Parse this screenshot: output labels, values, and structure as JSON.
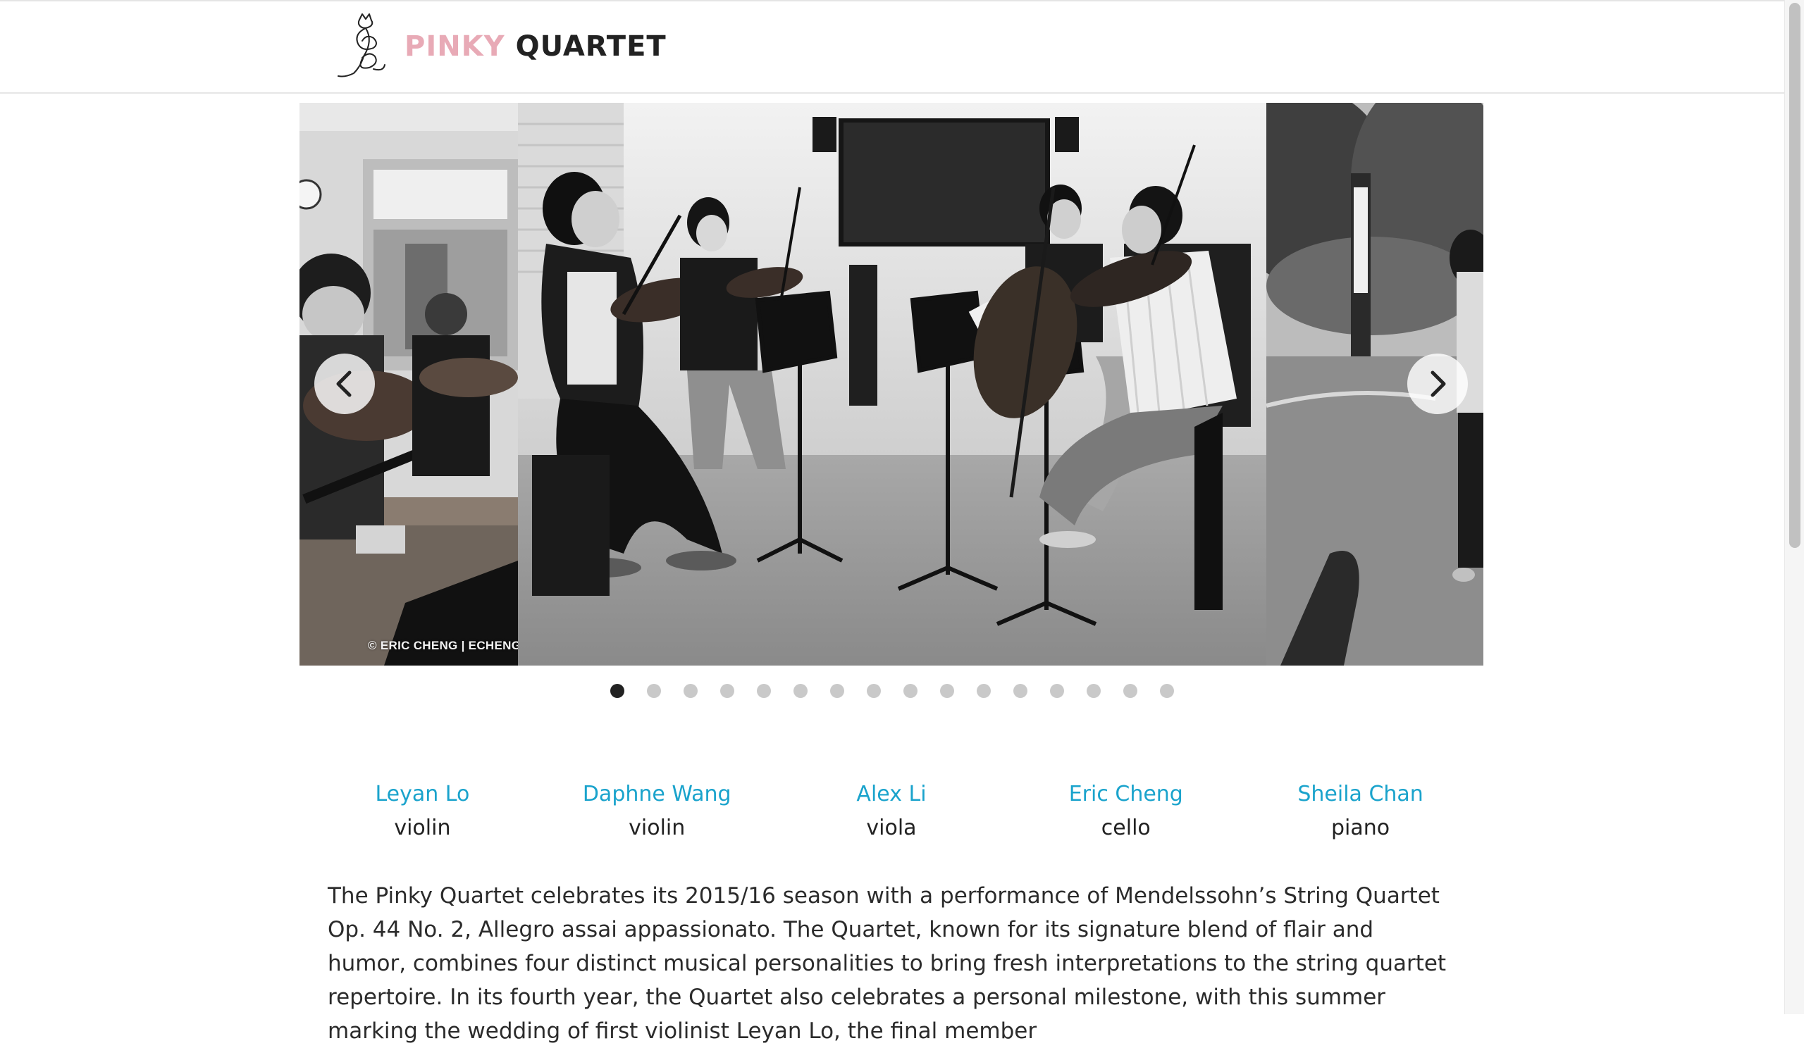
{
  "header": {
    "brand_part1": "PINKY",
    "brand_part2": "QUARTET",
    "logo_icon": "cat-treble-clef-icon"
  },
  "colors": {
    "brand_pink": "#e8aab6",
    "link_blue": "#1aa3cc",
    "text": "#222222",
    "dot_inactive": "#c9c9c9",
    "dot_active": "#222222"
  },
  "carousel": {
    "watermark": "© ERIC CHENG | ECHENG.",
    "prev_icon": "chevron-left-icon",
    "next_icon": "chevron-right-icon",
    "slide_count": 16,
    "active_slide": 1
  },
  "members": [
    {
      "name": "Leyan Lo",
      "instrument": "violin"
    },
    {
      "name": "Daphne Wang",
      "instrument": "violin"
    },
    {
      "name": "Alex Li",
      "instrument": "viola"
    },
    {
      "name": "Eric Cheng",
      "instrument": "cello"
    },
    {
      "name": "Sheila Chan",
      "instrument": "piano"
    }
  ],
  "intro": {
    "text": "The Pinky Quartet celebrates its 2015/16 season with a performance of Mendelssohn’s String Quartet Op. 44 No. 2, Allegro assai appassionato. The Quartet, known for its signature blend of flair and humor, combines four distinct musical personalities to bring fresh interpretations to the string quartet repertoire. In its fourth year, the Quartet also celebrates a personal milestone, with this summer marking the wedding of first violinist Leyan Lo, the final member"
  }
}
